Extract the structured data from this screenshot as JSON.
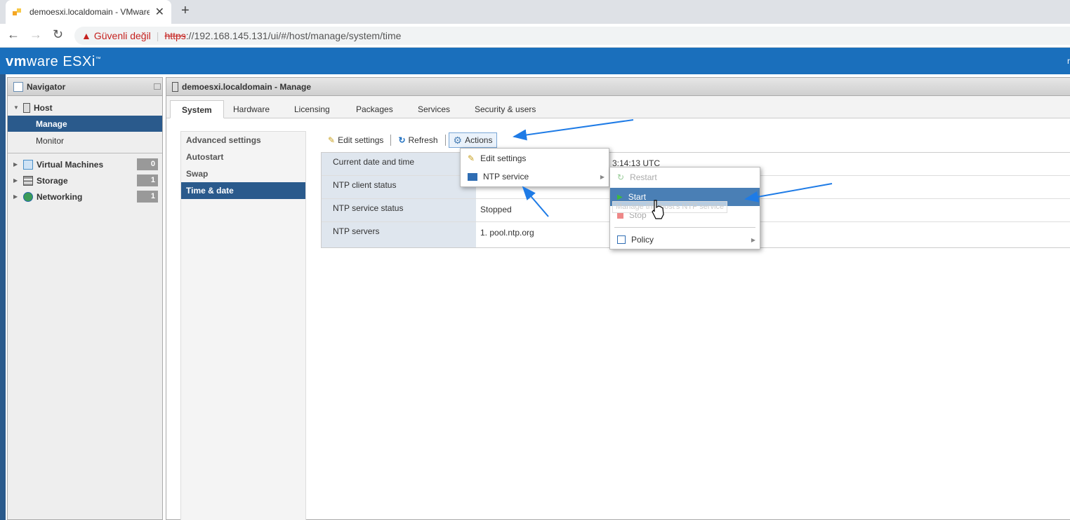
{
  "browser": {
    "tab_title": "demoesxi.localdomain - VMware ESXi",
    "tab_close": "✕",
    "new_tab": "+",
    "back": "←",
    "forward": "→",
    "reload": "↻",
    "security_warning": "Güvenli değil",
    "url_scheme": "https",
    "url_rest": "://192.168.145.131/ui/#/host/manage/system/time"
  },
  "header": {
    "logo_vm": "vm",
    "logo_ware": "ware",
    "logo_esxi": " ESXi",
    "logo_tm": "™",
    "user": "r"
  },
  "navigator": {
    "title": "Navigator",
    "host": "Host",
    "manage": "Manage",
    "monitor": "Monitor",
    "items": [
      {
        "label": "Virtual Machines",
        "count": "0"
      },
      {
        "label": "Storage",
        "count": "1"
      },
      {
        "label": "Networking",
        "count": "1"
      }
    ]
  },
  "main": {
    "title": "demoesxi.localdomain - Manage",
    "tabs": [
      "System",
      "Hardware",
      "Licensing",
      "Packages",
      "Services",
      "Security & users"
    ],
    "subnav": [
      "Advanced settings",
      "Autostart",
      "Swap",
      "Time & date"
    ],
    "toolbar": {
      "edit": "Edit settings",
      "refresh": "Refresh",
      "actions": "Actions"
    },
    "details": [
      {
        "label": "Current date and time",
        "value": "3:14:13 UTC"
      },
      {
        "label": "NTP client status",
        "value": ""
      },
      {
        "label": "NTP service status",
        "value": "Stopped"
      },
      {
        "label": "NTP servers",
        "value": "1. pool.ntp.org"
      }
    ]
  },
  "menu": {
    "edit_settings": "Edit settings",
    "ntp_service": "NTP service"
  },
  "submenu": {
    "restart": "Restart",
    "start": "Start",
    "stop": "Stop",
    "policy": "Policy",
    "tooltip": "Manage this host's NTP service"
  },
  "colors": {
    "accent": "#2a5a8c",
    "header": "#1a6fbc",
    "arrow": "#1e7be6"
  }
}
